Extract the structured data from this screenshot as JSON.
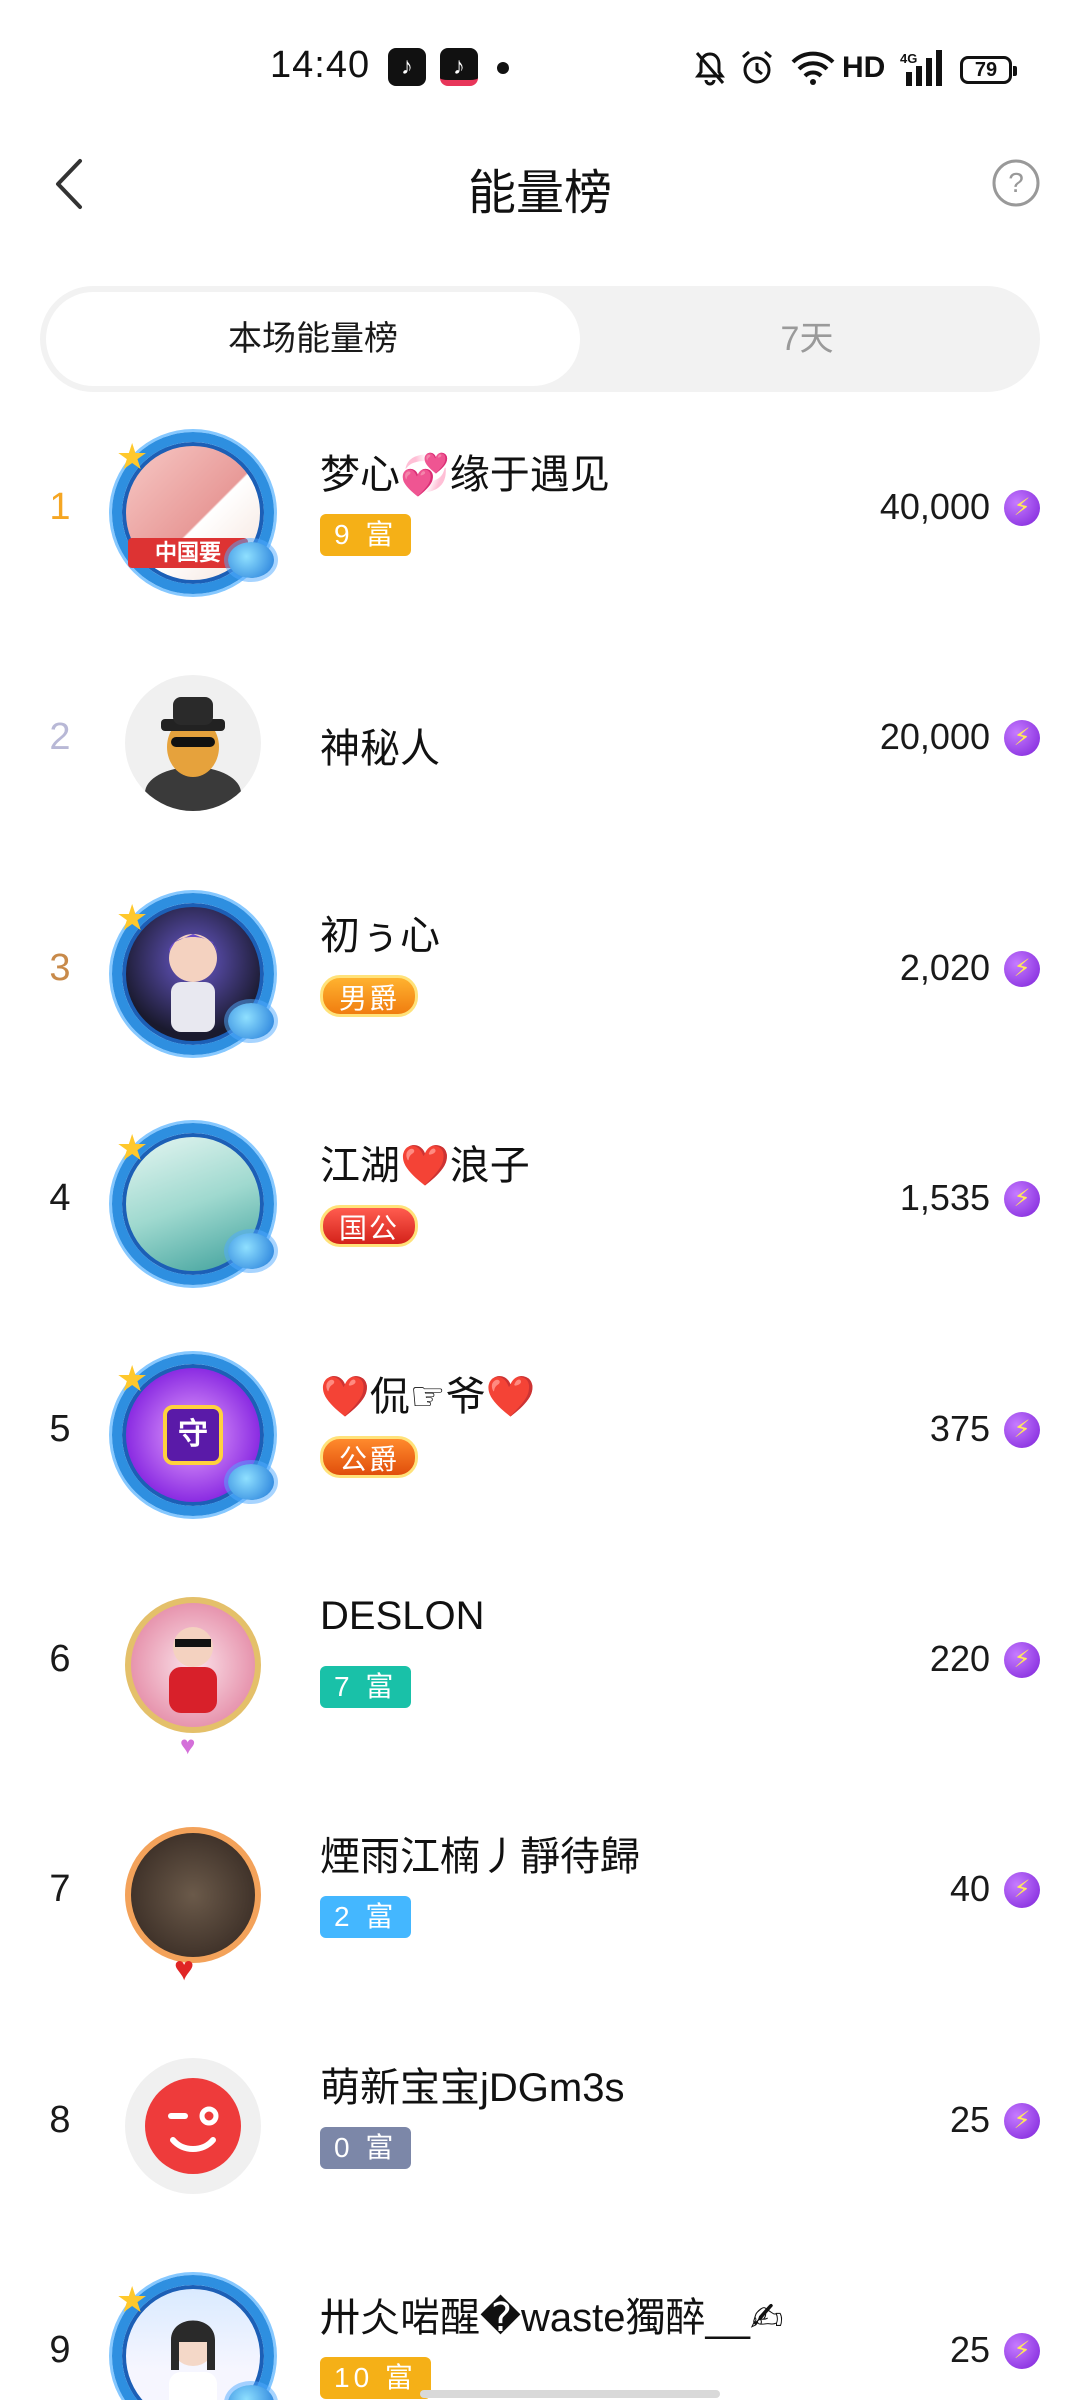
{
  "status_bar": {
    "time": "14:40",
    "battery": "79",
    "network": "HD",
    "signal_type": "4G",
    "icons": [
      "tiktok-icon",
      "tiktok-icon",
      "notification-dot-icon",
      "silent-bell-icon",
      "alarm-icon",
      "wifi-icon",
      "signal-icon",
      "battery-icon"
    ]
  },
  "header": {
    "title": "能量榜",
    "back_icon": "chevron-left-icon",
    "help_icon": "question-circle-icon"
  },
  "tabs": [
    {
      "label": "本场能量榜",
      "active": true
    },
    {
      "label": "7天",
      "active": false
    }
  ],
  "colors": {
    "rank1": "#f5a623",
    "rank2": "#b8b8d6",
    "rank3": "#c88a4a",
    "energy_icon": "#8a2be2"
  },
  "rows": [
    {
      "rank": "1",
      "name": "梦心💞缘于遇见",
      "badge": "9 富",
      "score": "40,000"
    },
    {
      "rank": "2",
      "name": "神秘人",
      "badge": "",
      "score": "20,000"
    },
    {
      "rank": "3",
      "name": "初ぅ心",
      "badge": "男爵",
      "score": "2,020"
    },
    {
      "rank": "4",
      "name": "江湖❤️浪子",
      "badge": "国公",
      "score": "1,535"
    },
    {
      "rank": "5",
      "name": "❤️侃☞爷❤️",
      "badge": "公爵",
      "score": "375"
    },
    {
      "rank": "6",
      "name": "DESLON",
      "badge": "7 富",
      "score": "220"
    },
    {
      "rank": "7",
      "name": "煙雨江楠丿靜待歸",
      "badge": "2 富",
      "score": "40"
    },
    {
      "rank": "8",
      "name": "萌新宝宝jDGm3s",
      "badge": "0 富",
      "score": "25"
    },
    {
      "rank": "9",
      "name": "卅仌啱醒�waste獨醉__✍",
      "badge": "10 富",
      "score": "25"
    }
  ],
  "avatar_texts": {
    "row1_overlay": "中国要",
    "row5_emblem": "守"
  }
}
